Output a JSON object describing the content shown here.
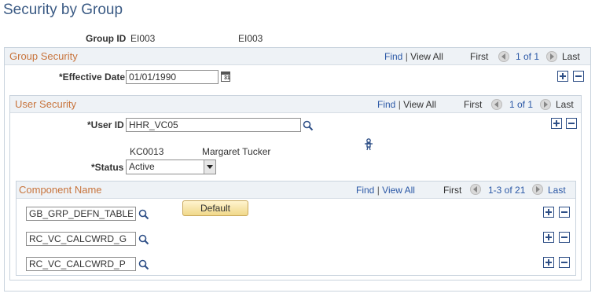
{
  "page_title": "Security by Group",
  "group_id": {
    "label": "Group ID",
    "value1": "EI003",
    "value2": "EI003"
  },
  "group_security": {
    "title": "Group Security",
    "nav": {
      "find": "Find",
      "sep": "|",
      "view_all": "View All",
      "first": "First",
      "count": "1 of 1",
      "last": "Last"
    },
    "effective_date": {
      "label": "*Effective Date",
      "value": "01/01/1990"
    }
  },
  "user_security": {
    "title": "User Security",
    "nav": {
      "find": "Find",
      "sep": "|",
      "view_all": "View All",
      "first": "First",
      "count": "1 of 1",
      "last": "Last"
    },
    "user_id": {
      "label": "*User ID",
      "value": "HHR_VC05"
    },
    "user_code": "KC0013",
    "user_name": "Margaret Tucker",
    "status": {
      "label": "*Status",
      "value": "Active"
    }
  },
  "component": {
    "title": "Component Name",
    "nav": {
      "find": "Find",
      "sep": "|",
      "view_all": "View All",
      "first": "First",
      "count": "1-3 of 21",
      "last": "Last"
    },
    "default_label": "Default",
    "rows": [
      {
        "value": "GB_GRP_DEFN_TABLE"
      },
      {
        "value": "RC_VC_CALCWRD_G"
      },
      {
        "value": "RC_VC_CALCWRD_P"
      }
    ]
  },
  "icons": {
    "calendar": "calendar-icon",
    "lookup": "magnifier-icon",
    "person": "person-icon",
    "add": "plus-icon",
    "delete": "minus-icon"
  }
}
